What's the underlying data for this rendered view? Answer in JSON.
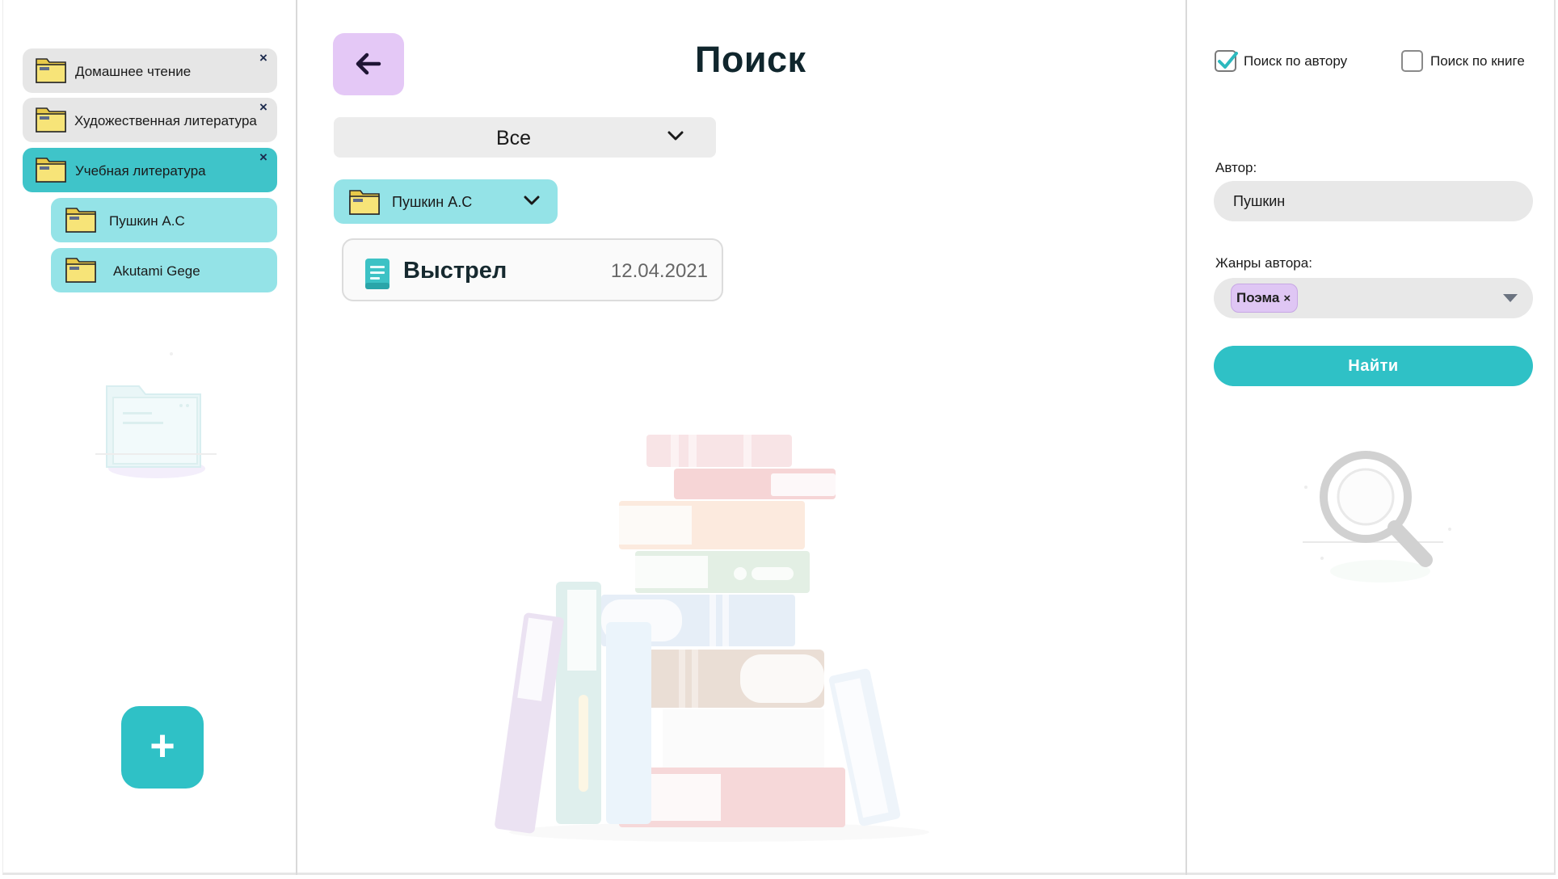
{
  "sidebar": {
    "folders": [
      {
        "label": "Домашнее чтение",
        "close": "×"
      },
      {
        "label": "Художественная литература",
        "close": "×"
      },
      {
        "label": "Учебная литература",
        "close": "×"
      }
    ],
    "subfolders": [
      {
        "label": "Пушкин А.С"
      },
      {
        "label": "Akutami Gege"
      }
    ],
    "add_button": "+"
  },
  "main": {
    "title": "Поиск",
    "filter_select": "Все",
    "author_chip": "Пушкин А.С",
    "results": [
      {
        "title": "Выстрел",
        "date": "12.04.2021"
      }
    ]
  },
  "search_panel": {
    "by_author": {
      "label": "Поиск по автору",
      "checked": true
    },
    "by_book": {
      "label": "Поиск по книге",
      "checked": false
    },
    "author_label": "Автор:",
    "author_value": "Пушкин",
    "genres_label": "Жанры автора:",
    "genre_tags": [
      {
        "label": "Поэма",
        "remove": "×"
      }
    ],
    "find_button": "Найти"
  },
  "colors": {
    "accent_teal": "#2fc1c6",
    "selected_folder": "#3fc4c9",
    "subfolder": "#94e3e7",
    "back_button": "#e4c8f6",
    "genre_tag": "#dfc6f4",
    "folder_icon": "#f7e478"
  },
  "icons": [
    "folder-icon",
    "close-icon",
    "arrow-left-icon",
    "chevron-down-icon",
    "book-icon",
    "check-icon",
    "caret-down-icon",
    "plus-icon",
    "folder-illustration",
    "books-stack-illustration",
    "magnifier-illustration"
  ]
}
